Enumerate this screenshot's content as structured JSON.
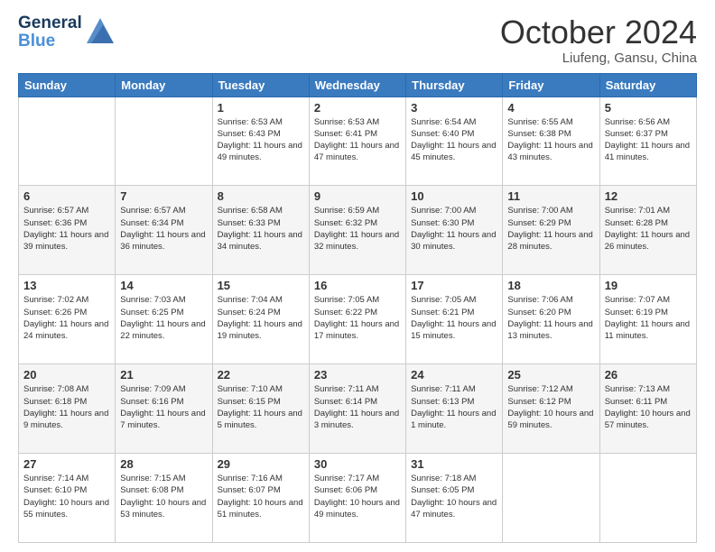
{
  "header": {
    "logo_line1": "General",
    "logo_line2": "Blue",
    "month_title": "October 2024",
    "location": "Liufeng, Gansu, China"
  },
  "weekdays": [
    "Sunday",
    "Monday",
    "Tuesday",
    "Wednesday",
    "Thursday",
    "Friday",
    "Saturday"
  ],
  "weeks": [
    [
      {
        "day": "",
        "info": ""
      },
      {
        "day": "",
        "info": ""
      },
      {
        "day": "1",
        "info": "Sunrise: 6:53 AM\nSunset: 6:43 PM\nDaylight: 11 hours and 49 minutes."
      },
      {
        "day": "2",
        "info": "Sunrise: 6:53 AM\nSunset: 6:41 PM\nDaylight: 11 hours and 47 minutes."
      },
      {
        "day": "3",
        "info": "Sunrise: 6:54 AM\nSunset: 6:40 PM\nDaylight: 11 hours and 45 minutes."
      },
      {
        "day": "4",
        "info": "Sunrise: 6:55 AM\nSunset: 6:38 PM\nDaylight: 11 hours and 43 minutes."
      },
      {
        "day": "5",
        "info": "Sunrise: 6:56 AM\nSunset: 6:37 PM\nDaylight: 11 hours and 41 minutes."
      }
    ],
    [
      {
        "day": "6",
        "info": "Sunrise: 6:57 AM\nSunset: 6:36 PM\nDaylight: 11 hours and 39 minutes."
      },
      {
        "day": "7",
        "info": "Sunrise: 6:57 AM\nSunset: 6:34 PM\nDaylight: 11 hours and 36 minutes."
      },
      {
        "day": "8",
        "info": "Sunrise: 6:58 AM\nSunset: 6:33 PM\nDaylight: 11 hours and 34 minutes."
      },
      {
        "day": "9",
        "info": "Sunrise: 6:59 AM\nSunset: 6:32 PM\nDaylight: 11 hours and 32 minutes."
      },
      {
        "day": "10",
        "info": "Sunrise: 7:00 AM\nSunset: 6:30 PM\nDaylight: 11 hours and 30 minutes."
      },
      {
        "day": "11",
        "info": "Sunrise: 7:00 AM\nSunset: 6:29 PM\nDaylight: 11 hours and 28 minutes."
      },
      {
        "day": "12",
        "info": "Sunrise: 7:01 AM\nSunset: 6:28 PM\nDaylight: 11 hours and 26 minutes."
      }
    ],
    [
      {
        "day": "13",
        "info": "Sunrise: 7:02 AM\nSunset: 6:26 PM\nDaylight: 11 hours and 24 minutes."
      },
      {
        "day": "14",
        "info": "Sunrise: 7:03 AM\nSunset: 6:25 PM\nDaylight: 11 hours and 22 minutes."
      },
      {
        "day": "15",
        "info": "Sunrise: 7:04 AM\nSunset: 6:24 PM\nDaylight: 11 hours and 19 minutes."
      },
      {
        "day": "16",
        "info": "Sunrise: 7:05 AM\nSunset: 6:22 PM\nDaylight: 11 hours and 17 minutes."
      },
      {
        "day": "17",
        "info": "Sunrise: 7:05 AM\nSunset: 6:21 PM\nDaylight: 11 hours and 15 minutes."
      },
      {
        "day": "18",
        "info": "Sunrise: 7:06 AM\nSunset: 6:20 PM\nDaylight: 11 hours and 13 minutes."
      },
      {
        "day": "19",
        "info": "Sunrise: 7:07 AM\nSunset: 6:19 PM\nDaylight: 11 hours and 11 minutes."
      }
    ],
    [
      {
        "day": "20",
        "info": "Sunrise: 7:08 AM\nSunset: 6:18 PM\nDaylight: 11 hours and 9 minutes."
      },
      {
        "day": "21",
        "info": "Sunrise: 7:09 AM\nSunset: 6:16 PM\nDaylight: 11 hours and 7 minutes."
      },
      {
        "day": "22",
        "info": "Sunrise: 7:10 AM\nSunset: 6:15 PM\nDaylight: 11 hours and 5 minutes."
      },
      {
        "day": "23",
        "info": "Sunrise: 7:11 AM\nSunset: 6:14 PM\nDaylight: 11 hours and 3 minutes."
      },
      {
        "day": "24",
        "info": "Sunrise: 7:11 AM\nSunset: 6:13 PM\nDaylight: 11 hours and 1 minute."
      },
      {
        "day": "25",
        "info": "Sunrise: 7:12 AM\nSunset: 6:12 PM\nDaylight: 10 hours and 59 minutes."
      },
      {
        "day": "26",
        "info": "Sunrise: 7:13 AM\nSunset: 6:11 PM\nDaylight: 10 hours and 57 minutes."
      }
    ],
    [
      {
        "day": "27",
        "info": "Sunrise: 7:14 AM\nSunset: 6:10 PM\nDaylight: 10 hours and 55 minutes."
      },
      {
        "day": "28",
        "info": "Sunrise: 7:15 AM\nSunset: 6:08 PM\nDaylight: 10 hours and 53 minutes."
      },
      {
        "day": "29",
        "info": "Sunrise: 7:16 AM\nSunset: 6:07 PM\nDaylight: 10 hours and 51 minutes."
      },
      {
        "day": "30",
        "info": "Sunrise: 7:17 AM\nSunset: 6:06 PM\nDaylight: 10 hours and 49 minutes."
      },
      {
        "day": "31",
        "info": "Sunrise: 7:18 AM\nSunset: 6:05 PM\nDaylight: 10 hours and 47 minutes."
      },
      {
        "day": "",
        "info": ""
      },
      {
        "day": "",
        "info": ""
      }
    ]
  ]
}
